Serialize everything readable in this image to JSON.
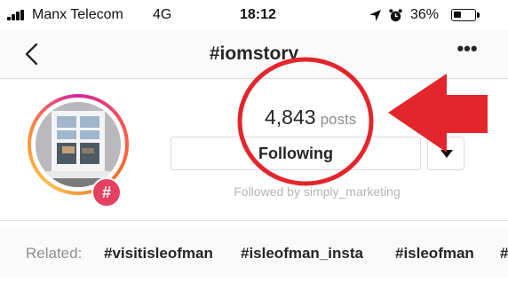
{
  "status_bar": {
    "carrier": "Manx Telecom",
    "network": "4G",
    "time": "18:12",
    "battery_percent": "36%",
    "battery_level": 0.36,
    "icons": [
      "signal-bars-icon",
      "location-arrow-icon",
      "alarm-clock-icon",
      "battery-icon"
    ]
  },
  "header": {
    "back_icon": "chevron-left-icon",
    "title": "#iomstory",
    "more_label": "•••"
  },
  "profile": {
    "badge_symbol": "#",
    "post_count": "4,843",
    "posts_label": "posts",
    "follow_button_label": "Following",
    "dropdown_icon": "caret-down-icon",
    "followed_by_text": "Followed by simply_marketing"
  },
  "related": {
    "label": "Related:",
    "tags": [
      "#visitisleofman",
      "#isleofman_insta",
      "#isleofman",
      "#"
    ]
  },
  "annotation": {
    "circle_color": "#e3262b",
    "arrow_color": "#e3262b"
  },
  "colors": {
    "accent_pink": "#d6249f",
    "badge_red": "#e4405f",
    "muted_text": "#8e8e8e",
    "border": "#dbdbdb"
  }
}
